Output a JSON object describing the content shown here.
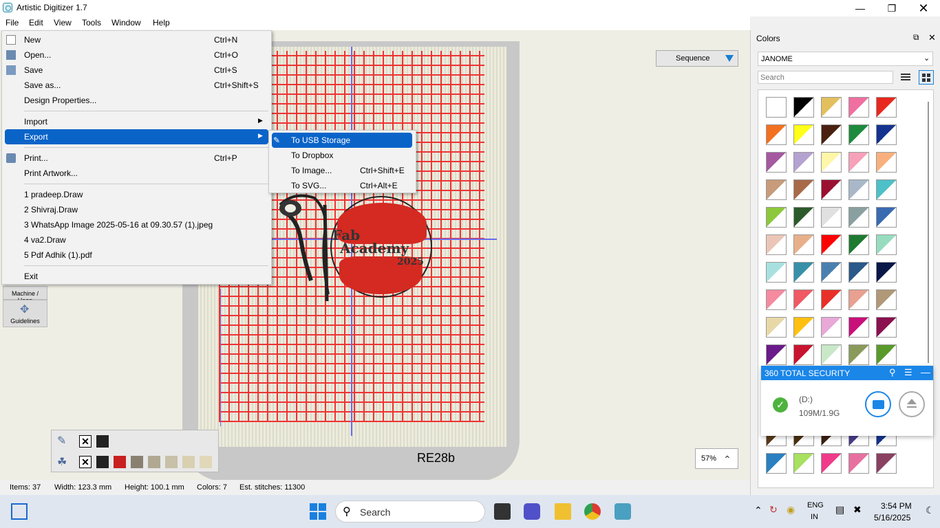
{
  "window": {
    "title": "Artistic Digitizer 1.7"
  },
  "menubar": {
    "file": "File",
    "edit": "Edit",
    "view": "View",
    "tools": "Tools",
    "window": "Window",
    "help": "Help"
  },
  "file_menu": {
    "new": {
      "label": "New",
      "shortcut": "Ctrl+N"
    },
    "open": {
      "label": "Open...",
      "shortcut": "Ctrl+O"
    },
    "save": {
      "label": "Save",
      "shortcut": "Ctrl+S"
    },
    "save_as": {
      "label": "Save as...",
      "shortcut": "Ctrl+Shift+S"
    },
    "design_properties": {
      "label": "Design Properties..."
    },
    "import": {
      "label": "Import"
    },
    "export": {
      "label": "Export"
    },
    "print": {
      "label": "Print...",
      "shortcut": "Ctrl+P"
    },
    "print_artwork": {
      "label": "Print Artwork..."
    },
    "recent": [
      "1 pradeep.Draw",
      "2 Shivraj.Draw",
      "3 WhatsApp Image 2025-05-16 at 09.30.57 (1).jpeg",
      "4 va2.Draw",
      "5 Pdf Adhik (1).pdf"
    ],
    "exit": {
      "label": "Exit"
    }
  },
  "export_menu": {
    "usb": {
      "label": "To USB Storage"
    },
    "dropbox": {
      "label": "To Dropbox"
    },
    "image": {
      "label": "To Image...",
      "shortcut": "Ctrl+Shift+E"
    },
    "svg": {
      "label": "To SVG...",
      "shortcut": "Ctrl+Alt+E"
    }
  },
  "canvas": {
    "sequence": "Sequence",
    "hoop_label": "RE28b",
    "zoom": "57%",
    "logo": {
      "line1": "Fab",
      "line2": "Academy",
      "line3": "2025"
    }
  },
  "left_tools": {
    "machine_hoop": "Machine / Hoop",
    "guidelines": "Guidelines"
  },
  "statusbar": {
    "items": "Items: 37",
    "width": "Width: 123.3 mm",
    "height": "Height: 100.1 mm",
    "colors": "Colors: 7",
    "stitches": "Est. stitches: 11300"
  },
  "colors_panel": {
    "title": "Colors",
    "brand": "JANOME",
    "search_placeholder": "Search",
    "swatches": [
      [
        "#ffffff",
        "#000000",
        "#e3bf5d",
        "#f06fa0",
        "#e8281e"
      ],
      [
        "#f37020",
        "#ffff1a",
        "#4a2010",
        "#1e8a3c",
        "#14338f"
      ],
      [
        "#a55aa0",
        "#b4a2d0",
        "#fff6a8",
        "#f7a1b9",
        "#f9b07e"
      ],
      [
        "#c89b7a",
        "#a86a48",
        "#9a1030",
        "#a8b8c8",
        "#4ec0c8"
      ],
      [
        "#8cc83c",
        "#2c5a2c",
        "#e0e0e0",
        "#8aa0a0",
        "#3a6ab0"
      ],
      [
        "#ebc6b8",
        "#e8b08a",
        "#ff0000",
        "#1e7a30",
        "#98dcc0"
      ],
      [
        "#a8e0e0",
        "#3890a8",
        "#4a80b0",
        "#2a5a8a",
        "#0a1848"
      ],
      [
        "#f58aa0",
        "#f05a64",
        "#e83028",
        "#e8a090",
        "#b09878"
      ],
      [
        "#e8d8a8",
        "#ffc010",
        "#e8a8d8",
        "#c8107a",
        "#8a1050"
      ],
      [
        "#6a1a8a",
        "#c81430",
        "#c8e8c8",
        "#8a9a5a",
        "#5a9a2a"
      ]
    ],
    "bottom_swatches": [
      [
        "#5a3a1a",
        "#4a3010",
        "#3a2010",
        "#4a3a8a",
        "#14338f"
      ],
      [
        "#2a80c0",
        "#a8e060",
        "#f03a8a",
        "#e870a0",
        "#8a4060"
      ]
    ]
  },
  "security": {
    "title": "360 TOTAL SECURITY",
    "drive": "(D:)",
    "size": "109M/1.9G"
  },
  "taskbar": {
    "search": "Search",
    "lang1": "ENG",
    "lang2": "IN",
    "time": "3:54 PM",
    "date": "5/16/2025"
  }
}
